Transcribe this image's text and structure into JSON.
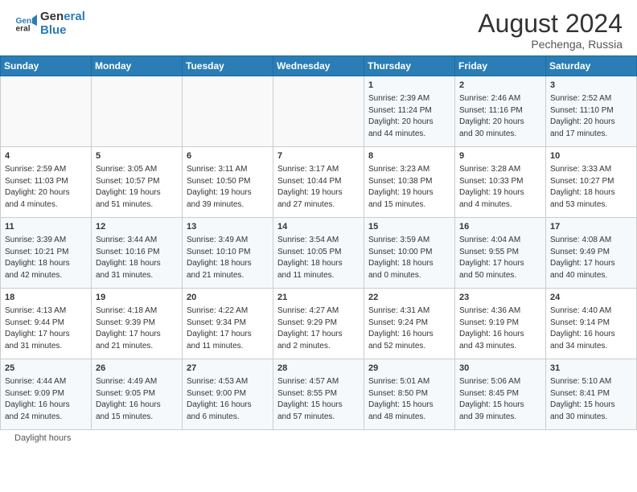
{
  "header": {
    "logo_line1": "General",
    "logo_line2": "Blue",
    "month_year": "August 2024",
    "location": "Pechenga, Russia"
  },
  "footer": {
    "daylight_label": "Daylight hours"
  },
  "days_of_week": [
    "Sunday",
    "Monday",
    "Tuesday",
    "Wednesday",
    "Thursday",
    "Friday",
    "Saturday"
  ],
  "weeks": [
    [
      {
        "day": "",
        "info": ""
      },
      {
        "day": "",
        "info": ""
      },
      {
        "day": "",
        "info": ""
      },
      {
        "day": "",
        "info": ""
      },
      {
        "day": "1",
        "info": "Sunrise: 2:39 AM\nSunset: 11:24 PM\nDaylight: 20 hours\nand 44 minutes."
      },
      {
        "day": "2",
        "info": "Sunrise: 2:46 AM\nSunset: 11:16 PM\nDaylight: 20 hours\nand 30 minutes."
      },
      {
        "day": "3",
        "info": "Sunrise: 2:52 AM\nSunset: 11:10 PM\nDaylight: 20 hours\nand 17 minutes."
      }
    ],
    [
      {
        "day": "4",
        "info": "Sunrise: 2:59 AM\nSunset: 11:03 PM\nDaylight: 20 hours\nand 4 minutes."
      },
      {
        "day": "5",
        "info": "Sunrise: 3:05 AM\nSunset: 10:57 PM\nDaylight: 19 hours\nand 51 minutes."
      },
      {
        "day": "6",
        "info": "Sunrise: 3:11 AM\nSunset: 10:50 PM\nDaylight: 19 hours\nand 39 minutes."
      },
      {
        "day": "7",
        "info": "Sunrise: 3:17 AM\nSunset: 10:44 PM\nDaylight: 19 hours\nand 27 minutes."
      },
      {
        "day": "8",
        "info": "Sunrise: 3:23 AM\nSunset: 10:38 PM\nDaylight: 19 hours\nand 15 minutes."
      },
      {
        "day": "9",
        "info": "Sunrise: 3:28 AM\nSunset: 10:33 PM\nDaylight: 19 hours\nand 4 minutes."
      },
      {
        "day": "10",
        "info": "Sunrise: 3:33 AM\nSunset: 10:27 PM\nDaylight: 18 hours\nand 53 minutes."
      }
    ],
    [
      {
        "day": "11",
        "info": "Sunrise: 3:39 AM\nSunset: 10:21 PM\nDaylight: 18 hours\nand 42 minutes."
      },
      {
        "day": "12",
        "info": "Sunrise: 3:44 AM\nSunset: 10:16 PM\nDaylight: 18 hours\nand 31 minutes."
      },
      {
        "day": "13",
        "info": "Sunrise: 3:49 AM\nSunset: 10:10 PM\nDaylight: 18 hours\nand 21 minutes."
      },
      {
        "day": "14",
        "info": "Sunrise: 3:54 AM\nSunset: 10:05 PM\nDaylight: 18 hours\nand 11 minutes."
      },
      {
        "day": "15",
        "info": "Sunrise: 3:59 AM\nSunset: 10:00 PM\nDaylight: 18 hours\nand 0 minutes."
      },
      {
        "day": "16",
        "info": "Sunrise: 4:04 AM\nSunset: 9:55 PM\nDaylight: 17 hours\nand 50 minutes."
      },
      {
        "day": "17",
        "info": "Sunrise: 4:08 AM\nSunset: 9:49 PM\nDaylight: 17 hours\nand 40 minutes."
      }
    ],
    [
      {
        "day": "18",
        "info": "Sunrise: 4:13 AM\nSunset: 9:44 PM\nDaylight: 17 hours\nand 31 minutes."
      },
      {
        "day": "19",
        "info": "Sunrise: 4:18 AM\nSunset: 9:39 PM\nDaylight: 17 hours\nand 21 minutes."
      },
      {
        "day": "20",
        "info": "Sunrise: 4:22 AM\nSunset: 9:34 PM\nDaylight: 17 hours\nand 11 minutes."
      },
      {
        "day": "21",
        "info": "Sunrise: 4:27 AM\nSunset: 9:29 PM\nDaylight: 17 hours\nand 2 minutes."
      },
      {
        "day": "22",
        "info": "Sunrise: 4:31 AM\nSunset: 9:24 PM\nDaylight: 16 hours\nand 52 minutes."
      },
      {
        "day": "23",
        "info": "Sunrise: 4:36 AM\nSunset: 9:19 PM\nDaylight: 16 hours\nand 43 minutes."
      },
      {
        "day": "24",
        "info": "Sunrise: 4:40 AM\nSunset: 9:14 PM\nDaylight: 16 hours\nand 34 minutes."
      }
    ],
    [
      {
        "day": "25",
        "info": "Sunrise: 4:44 AM\nSunset: 9:09 PM\nDaylight: 16 hours\nand 24 minutes."
      },
      {
        "day": "26",
        "info": "Sunrise: 4:49 AM\nSunset: 9:05 PM\nDaylight: 16 hours\nand 15 minutes."
      },
      {
        "day": "27",
        "info": "Sunrise: 4:53 AM\nSunset: 9:00 PM\nDaylight: 16 hours\nand 6 minutes."
      },
      {
        "day": "28",
        "info": "Sunrise: 4:57 AM\nSunset: 8:55 PM\nDaylight: 15 hours\nand 57 minutes."
      },
      {
        "day": "29",
        "info": "Sunrise: 5:01 AM\nSunset: 8:50 PM\nDaylight: 15 hours\nand 48 minutes."
      },
      {
        "day": "30",
        "info": "Sunrise: 5:06 AM\nSunset: 8:45 PM\nDaylight: 15 hours\nand 39 minutes."
      },
      {
        "day": "31",
        "info": "Sunrise: 5:10 AM\nSunset: 8:41 PM\nDaylight: 15 hours\nand 30 minutes."
      }
    ]
  ]
}
